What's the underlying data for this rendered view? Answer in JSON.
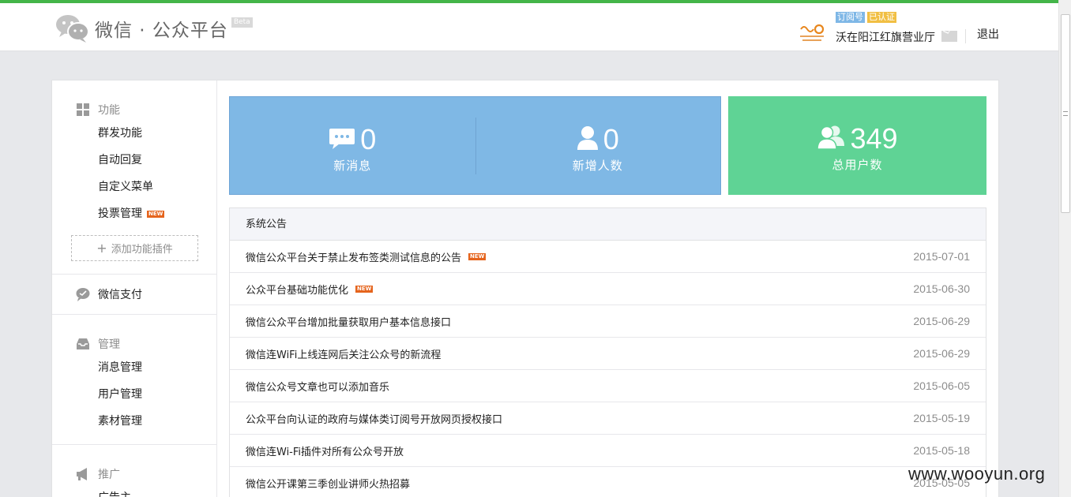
{
  "header": {
    "title": "微信 · 公众平台",
    "beta": "Beta",
    "account": {
      "tag_type": "订阅号",
      "tag_verified": "已认证",
      "name": "沃在阳江红旗营业厅",
      "logout": "退出"
    }
  },
  "sidebar": {
    "function": {
      "head": "功能",
      "items": [
        "群发功能",
        "自动回复",
        "自定义菜单",
        "投票管理"
      ],
      "new_badge": "NEW",
      "add_plugin": "添加功能插件"
    },
    "pay": {
      "head": "微信支付"
    },
    "manage": {
      "head": "管理",
      "items": [
        "消息管理",
        "用户管理",
        "素材管理"
      ]
    },
    "promote": {
      "head": "推广",
      "items": [
        "广告主"
      ]
    }
  },
  "stats": {
    "new_messages": {
      "value": "0",
      "label": "新消息"
    },
    "new_users": {
      "value": "0",
      "label": "新增人数"
    },
    "total_users": {
      "value": "349",
      "label": "总用户数"
    }
  },
  "notices": {
    "head": "系统公告",
    "new_badge": "NEW",
    "rows": [
      {
        "title": "微信公众平台关于禁止发布签类测试信息的公告",
        "date": "2015-07-01",
        "new": true
      },
      {
        "title": "公众平台基础功能优化",
        "date": "2015-06-30",
        "new": true
      },
      {
        "title": "微信公众平台增加批量获取用户基本信息接口",
        "date": "2015-06-29",
        "new": false
      },
      {
        "title": "微信连WiFi上线连网后关注公众号的新流程",
        "date": "2015-06-29",
        "new": false
      },
      {
        "title": "微信公众号文章也可以添加音乐",
        "date": "2015-06-05",
        "new": false
      },
      {
        "title": "公众平台向认证的政府与媒体类订阅号开放网页授权接口",
        "date": "2015-05-19",
        "new": false
      },
      {
        "title": "微信连Wi-Fi插件对所有公众号开放",
        "date": "2015-05-18",
        "new": false
      },
      {
        "title": "微信公开课第三季创业讲师火热招募",
        "date": "2015-05-05",
        "new": false
      }
    ]
  },
  "watermark": "www.wooyun.org",
  "colors": {
    "accent_green": "#44b549",
    "stat_blue": "#7fb8e5",
    "stat_green": "#5fd395",
    "new_badge": "#e5641d"
  }
}
